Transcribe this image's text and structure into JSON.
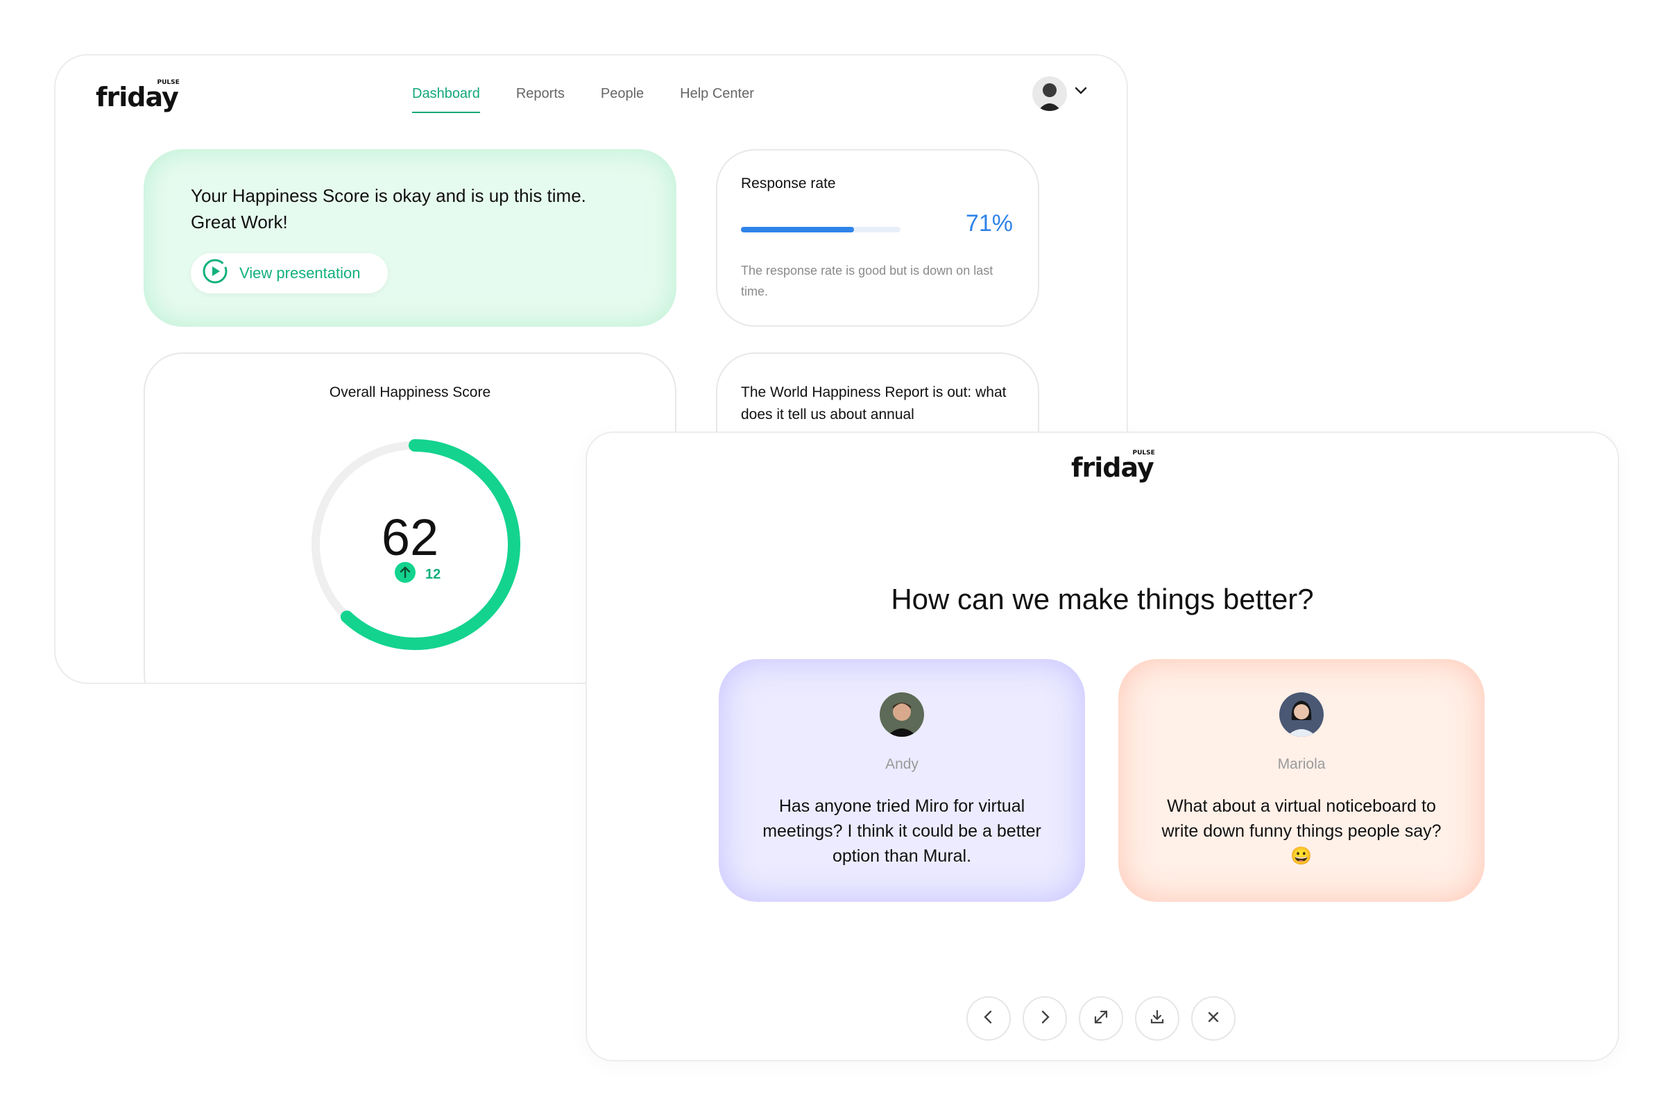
{
  "dashboard": {
    "logo": {
      "word": "friday",
      "tag": "PULSE"
    },
    "nav": [
      {
        "label": "Dashboard",
        "active": true
      },
      {
        "label": "Reports",
        "active": false
      },
      {
        "label": "People",
        "active": false
      },
      {
        "label": "Help Center",
        "active": false
      }
    ],
    "happiness_card": {
      "text": "Your Happiness Score is okay and is up this time. Great Work!",
      "button_label": "View presentation"
    },
    "response_card": {
      "title": "Response rate",
      "percent_label": "71%",
      "fraction": 0.71,
      "description": "The response rate is good but is down on last time."
    },
    "score_card": {
      "title": "Overall Happiness Score",
      "score": "62",
      "fraction": 0.62,
      "change": "12"
    },
    "world_card": {
      "text": "The World Happiness Report is out: what does it tell us about annual"
    }
  },
  "presentation": {
    "logo": {
      "word": "friday",
      "tag": "PULSE"
    },
    "question": "How can we make things better?",
    "feedback": [
      {
        "name": "Andy",
        "message": "Has anyone tried Miro for virtual meetings? I think it could be a better option than Mural."
      },
      {
        "name": "Mariola",
        "message": "What about a virtual noticeboard to write down funny things people say? 😀"
      }
    ],
    "controls": [
      "chevron-left-icon",
      "chevron-right-icon",
      "expand-icon",
      "download-icon",
      "close-icon"
    ]
  },
  "colors": {
    "accent_green": "#13a77a",
    "accent_blue": "#2f83e8"
  }
}
